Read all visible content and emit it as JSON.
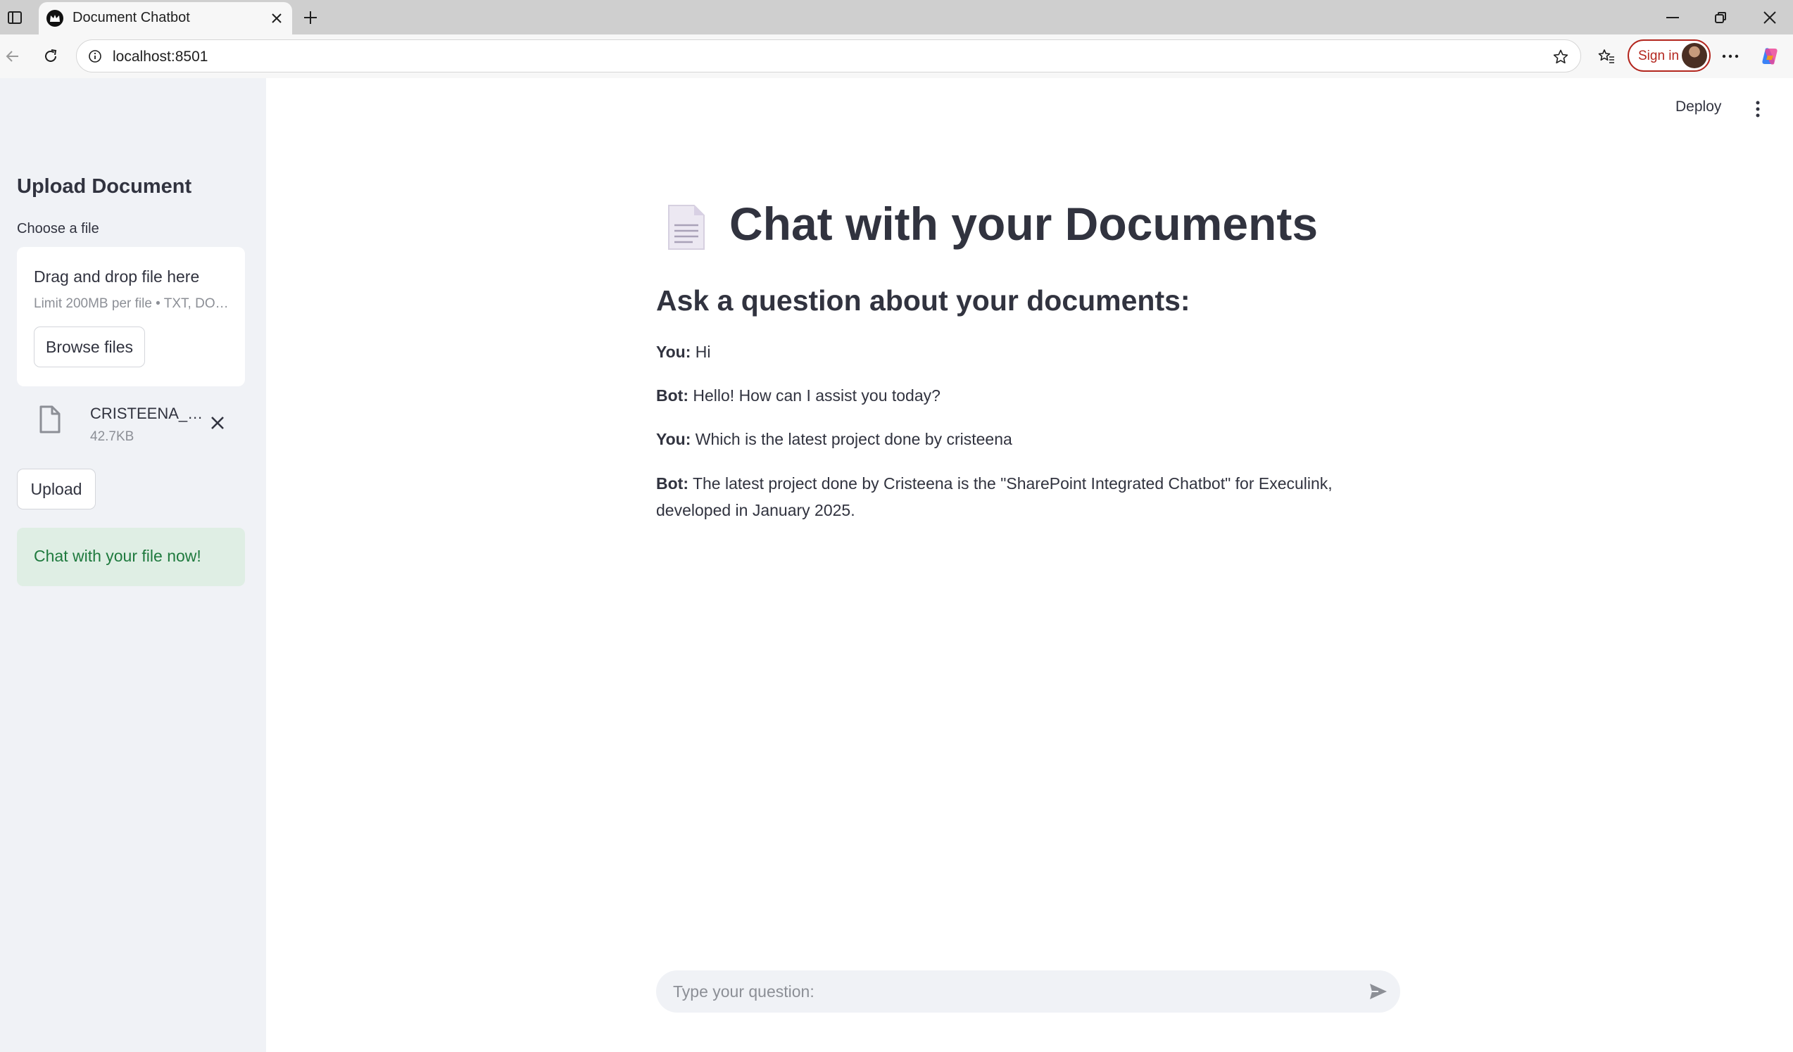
{
  "browser": {
    "tab_title": "Document Chatbot",
    "url": "localhost:8501",
    "signin_label": "Sign in"
  },
  "icons": {
    "sidebar_toggle": "tab-actions-icon",
    "favicon": "streamlit-crown-icon",
    "close": "close-icon",
    "new_tab": "plus-icon",
    "back": "arrow-left-icon",
    "reload": "reload-icon",
    "site_info": "info-icon",
    "favorite": "star-icon",
    "favorites_bar": "favorites-icon",
    "more": "ellipsis-icon",
    "copilot": "copilot-icon",
    "file": "file-icon",
    "send": "send-icon",
    "app_menu": "kebab-icon"
  },
  "sidebar": {
    "heading": "Upload Document",
    "uploader_label": "Choose a file",
    "dropzone_title": "Drag and drop file here",
    "dropzone_limit": "Limit 200MB per file • TXT, DO…",
    "browse_label": "Browse files",
    "file": {
      "name": "CRISTEENA_J…",
      "size": "42.7KB"
    },
    "upload_label": "Upload",
    "success_text": "Chat with your file now!"
  },
  "main": {
    "deploy_label": "Deploy",
    "title": "Chat with your Documents",
    "subheading": "Ask a question about your documents:",
    "messages": [
      {
        "speaker": "You:",
        "text": "Hi"
      },
      {
        "speaker": "Bot:",
        "text": "Hello! How can I assist you today?"
      },
      {
        "speaker": "You:",
        "text": "Which is the latest project done by cristeena"
      },
      {
        "speaker": "Bot:",
        "text": "The latest project done by Cristeena is the \"SharePoint Integrated Chatbot\" for Execulink, developed in January 2025."
      }
    ],
    "input_placeholder": "Type your question:"
  },
  "colors": {
    "sidebar_bg": "#f0f2f6",
    "text": "#31333f",
    "success_bg": "#dfeee4",
    "success_text": "#1f7a3e",
    "signin_accent": "#b3261e"
  }
}
